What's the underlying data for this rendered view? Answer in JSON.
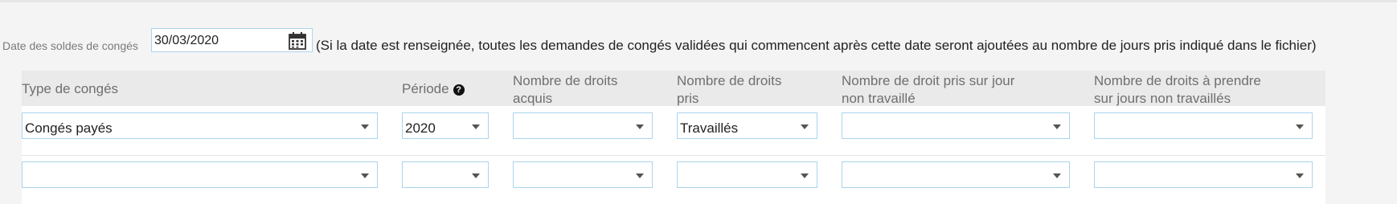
{
  "date_field": {
    "label": "Date des soldes de congés",
    "value": "30/03/2020",
    "note": "(Si la date est renseignée, toutes les demandes de congés validées qui commencent après cette date seront ajoutées au nombre de jours pris indiqué dans le fichier)"
  },
  "table": {
    "headers": {
      "type": "Type de congés",
      "periode": "Période",
      "acquis_l1": "Nombre de droits",
      "acquis_l2": "acquis",
      "pris_l1": "Nombre de droits",
      "pris_l2": "pris",
      "nontrav_l1": "Nombre de droit pris sur jour",
      "nontrav_l2": "non travaillé",
      "aprendre_l1": "Nombre de droits à prendre",
      "aprendre_l2": "sur jours non travaillés"
    },
    "rows": [
      {
        "type": "Congés payés",
        "periode": "2020",
        "acquis": "",
        "pris": "Travaillés",
        "nontrav": "",
        "aprendre": ""
      },
      {
        "type": "",
        "periode": "",
        "acquis": "",
        "pris": "",
        "nontrav": "",
        "aprendre": ""
      }
    ]
  },
  "icons": {
    "calendar": "calendar-icon",
    "help": "question-circle-icon",
    "dropdown": "caret-down-icon"
  },
  "colors": {
    "input_border": "#aad4ee",
    "header_bg": "#eaeaea",
    "header_text": "#6f6f6f"
  }
}
